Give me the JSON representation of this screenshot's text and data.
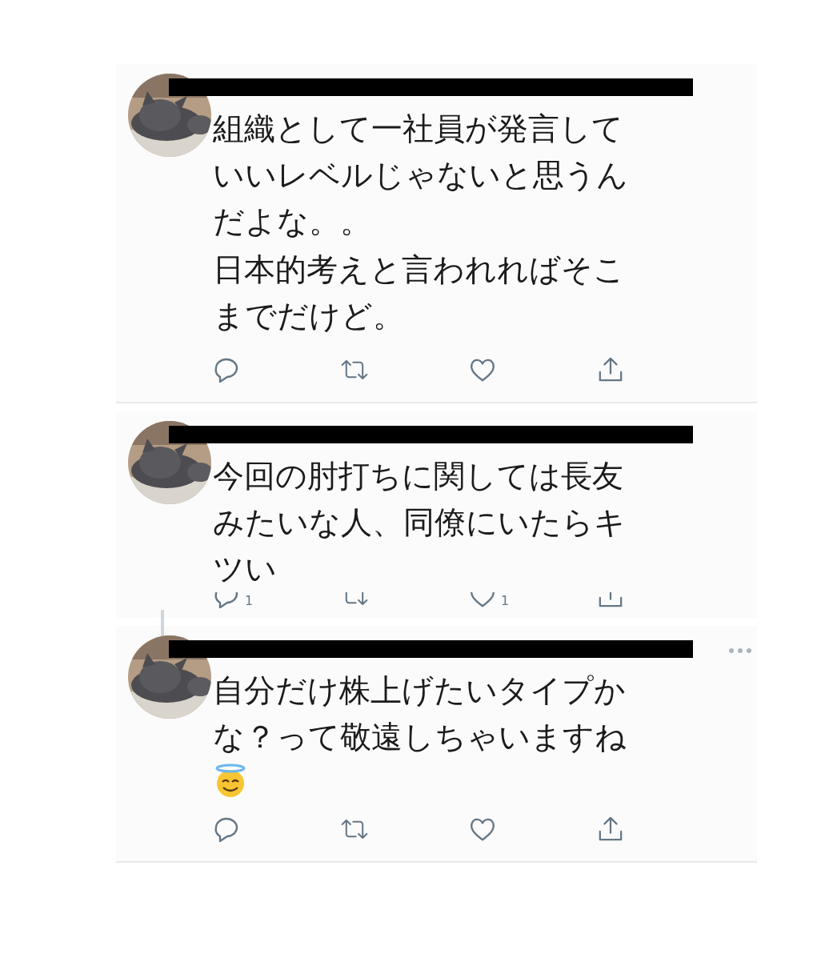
{
  "tweets": [
    {
      "paragraphs": [
        "組織として一社員が発言していいレベルじゃないと思うんだよな。。",
        "日本的考えと言われればそこまでだけど。"
      ],
      "header_redacted": true,
      "actions_clipped": false,
      "thread_below": false,
      "separator": true
    },
    {
      "paragraphs": [
        "今回の肘打ちに関しては長友みたいな人、同僚にいたらキツい"
      ],
      "header_redacted": true,
      "actions_clipped": true,
      "reply_count": "1",
      "like_count": "1",
      "thread_below": true,
      "separator": false
    },
    {
      "paragraphs": [
        "自分だけ株上げたいタイプかな？って敬遠しちゃいますね"
      ],
      "halo_emoji": true,
      "header_redacted": true,
      "actions_clipped": false,
      "thread_below": false,
      "separator": true,
      "more_menu": true
    }
  ]
}
